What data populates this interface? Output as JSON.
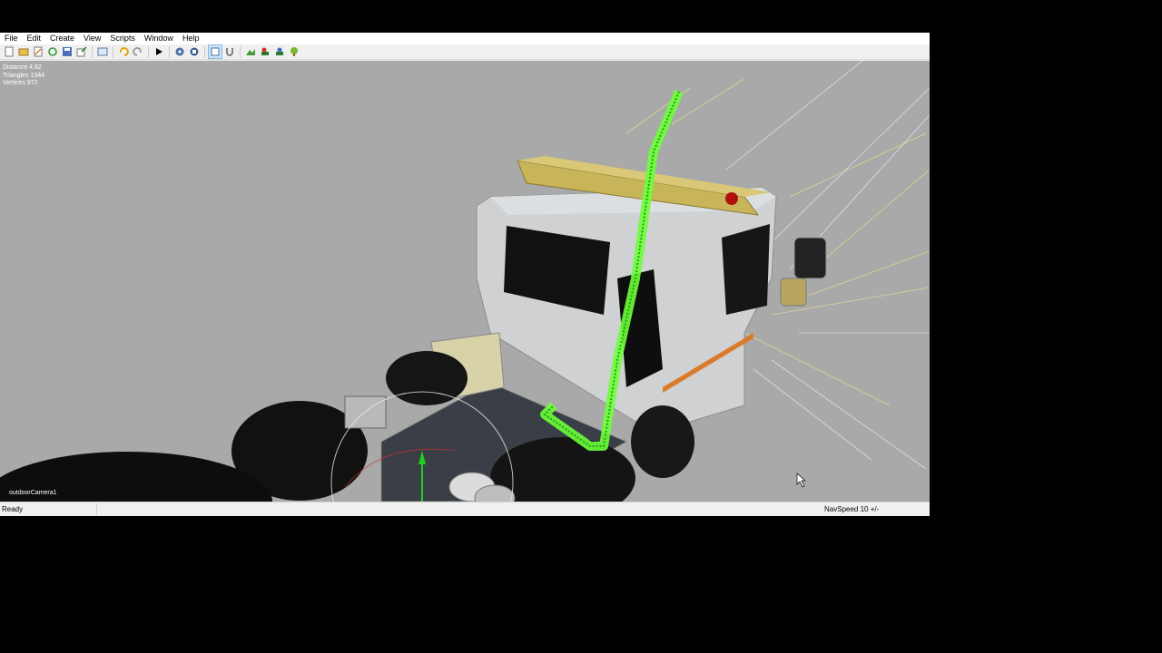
{
  "menu": [
    "File",
    "Edit",
    "Create",
    "View",
    "Scripts",
    "Window",
    "Help"
  ],
  "toolbar": {
    "icons": [
      "new-file-icon",
      "open-file-icon",
      "edit-file-icon",
      "reload-icon",
      "save-icon",
      "export-icon",
      "find-icon",
      "undo-icon",
      "redo-icon",
      "play-icon",
      "orbit-icon",
      "camera-icon",
      "select-icon",
      "magnet-icon",
      "terrain-icon",
      "paint-icon",
      "paint-bucket-icon",
      "foliage-icon"
    ]
  },
  "viewport": {
    "stats": {
      "distance": "Distance 4.82",
      "triangles": "Triangles 1344",
      "vertices": "Vertices 972"
    },
    "camera_label": "outdoorCamera1",
    "background_color": "#a9a9a9",
    "highlight_color": "#6cff3a"
  },
  "statusbar": {
    "status": "Ready",
    "navspeed": "NavSpeed 10 +/-"
  }
}
